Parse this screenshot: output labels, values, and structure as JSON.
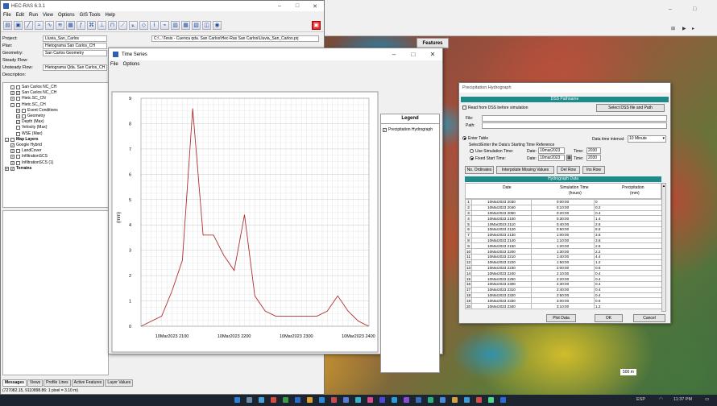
{
  "ras": {
    "title": "HEC-RAS 6.3.1",
    "menu": [
      "File",
      "Edit",
      "Run",
      "View",
      "Options",
      "GIS Tools",
      "Help"
    ],
    "labels": {
      "project": "Project:",
      "plan": "Plan:",
      "geometry": "Geometry:",
      "steady": "Steady Flow:",
      "unsteady": "Unsteady Flow:",
      "description": "Description:"
    },
    "values": {
      "project": "Lluvia_San_Carlos",
      "project_file": "C:\\...\\Tesis - Cuenca qda. San Carlos\\Hec-Ras San Carlos\\Lluvia_San_Carlos.prj",
      "plan": "Hietograma San Carlos_CH",
      "geometry": "San Carlos Geometry",
      "unsteady": "Hietograma Qda. San Carlos_CH"
    },
    "tree": [
      {
        "t": "San Carlos NC_CH",
        "lvl": 1,
        "box": "-"
      },
      {
        "t": "San Carlos NC_CH",
        "lvl": 1,
        "box": "+",
        "chk": true
      },
      {
        "t": "Hietc.SC_CN",
        "lvl": 1,
        "box": "+"
      },
      {
        "t": "Hietc.SC_CH",
        "lvl": 1,
        "box": "-"
      },
      {
        "t": "Event Conditions",
        "lvl": 2,
        "box": "+"
      },
      {
        "t": "Geometry",
        "lvl": 2,
        "box": "+"
      },
      {
        "t": "Depth (Max)",
        "lvl": 2,
        "chk": true
      },
      {
        "t": "Velocity (Max)",
        "lvl": 2
      },
      {
        "t": "WSE (Max)",
        "lvl": 2
      },
      {
        "t": "Map Layers",
        "lvl": 0,
        "box": "-",
        "bold": true
      },
      {
        "t": "Google Hybrid",
        "lvl": 1,
        "chk": true
      },
      {
        "t": "LandCover",
        "lvl": 1,
        "box": "+"
      },
      {
        "t": "InfiltrationSCS",
        "lvl": 1,
        "box": "+"
      },
      {
        "t": "InfiltrationSCS (1)",
        "lvl": 1,
        "box": "+"
      },
      {
        "t": "Terrains",
        "lvl": 0,
        "box": "+",
        "chk": true,
        "bold": true
      }
    ],
    "bottom_tabs": [
      "Messages",
      "Views",
      "Profile Lines",
      "Active Features",
      "Layer Values"
    ],
    "coords": "(727082.15, 9110898.86: 1 pixel = 3.10 m)"
  },
  "map": {
    "features_tab": "Features",
    "scale": "500 m"
  },
  "ts": {
    "title": "Time Series",
    "menu": [
      "File",
      "Options"
    ],
    "legend_title": "Legend",
    "legend_entry": "Precipitation Hydrograph"
  },
  "chart_data": {
    "type": "line",
    "ylabel": "(mm)",
    "ylim": [
      0,
      9
    ],
    "yticks": [
      0,
      1,
      2,
      3,
      4,
      5,
      6,
      7,
      8,
      9
    ],
    "xticks": [
      "10Mar2023 2100",
      "10Mar2023 2200",
      "10Mar2023 2300",
      "10Mar2023 2400"
    ],
    "x_hours": [
      0,
      0.333,
      0.5,
      0.667,
      0.833,
      1.0,
      1.167,
      1.333,
      1.5,
      1.667,
      1.833,
      2.0,
      2.167,
      2.333,
      2.5,
      2.667,
      2.833,
      3.0,
      3.167,
      3.333,
      3.5,
      3.667
    ],
    "x_hour_offset_of_first_tick": 0.5,
    "series": [
      {
        "name": "Precipitation Hydrograph",
        "color": "#b03030",
        "values": [
          0,
          0.4,
          1.4,
          2.6,
          8.6,
          3.6,
          3.6,
          2.8,
          2.2,
          4.4,
          1.2,
          0.6,
          0.4,
          0.4,
          0.4,
          0.4,
          0.4,
          0.6,
          1.2,
          0.6,
          0.2,
          0
        ]
      }
    ]
  },
  "ph": {
    "title": "Precipitation Hydrograph",
    "dss_bar": "DSS Pathname",
    "read_dss": "Read from DSS before simulation",
    "select_dss": "Select DSS file and Path",
    "file_label": "File:",
    "path_label": "Path:",
    "enter_table": "Enter Table",
    "interval_label": "Data time interval:",
    "interval_value": "10 Minute",
    "select_ref": "Select/Enter the Data's Starting Time Reference",
    "use_sim_time": "Use Simulation Time:",
    "fixed_start": "Fixed Start Time:",
    "date_label": "Date:",
    "time_label": "Time:",
    "sim_date": "10mar2023",
    "sim_time": "2030",
    "fixed_date": "10mar2023",
    "fixed_time": "2030",
    "btn_ordinates": "No. Ordinates",
    "btn_interp": "Interpolate Missing Values",
    "btn_delrow": "Del Row",
    "btn_insrow": "Ins Row",
    "table_bar": "Hydrograph Data",
    "col_date": "Date",
    "col_sim": "Simulation Time",
    "col_sim_unit": "(hours)",
    "col_precip": "Precipitation",
    "col_precip_unit": "(mm)",
    "rows": [
      [
        "1",
        "10Mar2023 2030",
        "0:00:00",
        "0"
      ],
      [
        "2",
        "10Mar2023 2040",
        "0:10:00",
        "0.2"
      ],
      [
        "3",
        "10Mar2023 2050",
        "0:20:00",
        "0.4"
      ],
      [
        "4",
        "10Mar2023 2100",
        "0:30:00",
        "1.4"
      ],
      [
        "5",
        "10Mar2023 2110",
        "0:40:00",
        "2.6"
      ],
      [
        "6",
        "10Mar2023 2120",
        "0:50:00",
        "8.6"
      ],
      [
        "7",
        "10Mar2023 2130",
        "1:00:00",
        "3.6"
      ],
      [
        "8",
        "10Mar2023 2140",
        "1:10:00",
        "3.6"
      ],
      [
        "9",
        "10Mar2023 2150",
        "1:20:00",
        "2.8"
      ],
      [
        "10",
        "10Mar2023 2200",
        "1:30:00",
        "2.2"
      ],
      [
        "11",
        "10Mar2023 2210",
        "1:40:00",
        "4.4"
      ],
      [
        "12",
        "10Mar2023 2220",
        "1:50:00",
        "1.2"
      ],
      [
        "13",
        "10Mar2023 2230",
        "2:00:00",
        "0.6"
      ],
      [
        "14",
        "10Mar2023 2240",
        "2:10:00",
        "0.4"
      ],
      [
        "15",
        "10Mar2023 2250",
        "2:20:00",
        "0.4"
      ],
      [
        "16",
        "10Mar2023 2300",
        "2:30:00",
        "0.4"
      ],
      [
        "17",
        "10Mar2023 2310",
        "2:40:00",
        "0.4"
      ],
      [
        "18",
        "10Mar2023 2320",
        "2:50:00",
        "0.4"
      ],
      [
        "19",
        "10Mar2023 2330",
        "3:00:00",
        "0.6"
      ],
      [
        "20",
        "10Mar2023 2340",
        "3:10:00",
        "1.2"
      ]
    ],
    "btn_plot": "Plot Data",
    "btn_ok": "OK",
    "btn_cancel": "Cancel"
  },
  "taskbar": {
    "tray": "ESP",
    "clock": "11:37 PM"
  }
}
